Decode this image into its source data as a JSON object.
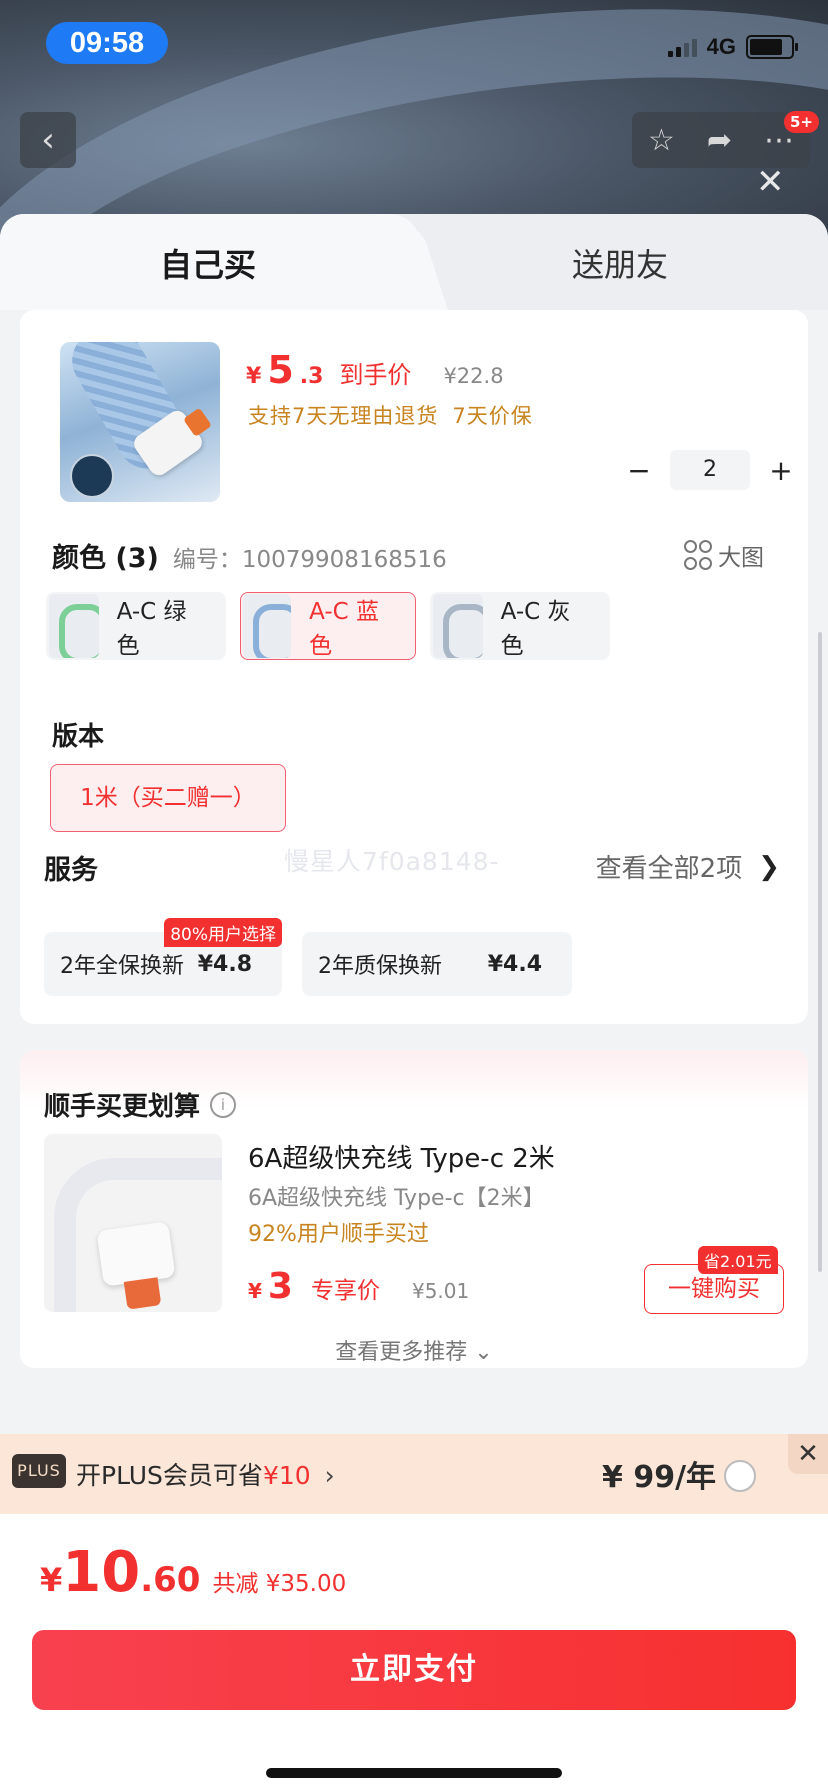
{
  "status_bar": {
    "time": "09:58",
    "network": "4G"
  },
  "nav": {
    "back_icon": "‹",
    "badge": "5+"
  },
  "tabs": [
    {
      "label": "自己买"
    },
    {
      "label": "送朋友"
    }
  ],
  "product": {
    "price_symbol": "¥",
    "price_int": "5",
    "price_dec": ".3",
    "price_tag": "到手价",
    "original_price": "¥22.8",
    "policies": [
      "支持7天无理由退货",
      "7天价保"
    ],
    "quantity": "2"
  },
  "color_section": {
    "title": "颜色 (3)",
    "sku": "编号：10079908168516",
    "big_image_label": "大图",
    "options": [
      {
        "label": "A-C 绿色",
        "selected": false,
        "swatch": "#7ccf96"
      },
      {
        "label": "A-C 蓝色",
        "selected": true,
        "swatch": "#8ab0d9"
      },
      {
        "label": "A-C 灰色",
        "selected": false,
        "swatch": "#a8b6c6"
      }
    ]
  },
  "version_section": {
    "title": "版本",
    "option": "1米（买二赠一）"
  },
  "service_section": {
    "title": "服务",
    "watermark": "慢星人7f0a8148-",
    "view_all": "查看全部2项",
    "options": [
      {
        "label": "2年全保换新",
        "price": "¥4.8",
        "badge": "80%用户选择"
      },
      {
        "label": "2年质保换新",
        "price": "¥4.4"
      }
    ]
  },
  "recommend": {
    "title": "顺手买更划算",
    "name": "6A超级快充线 Type-c 2米",
    "sub": "6A超级快充线 Type-c【2米】",
    "pct": "92%用户顺手买过",
    "price_symbol": "¥",
    "price": "3",
    "price_tag": "专享价",
    "original_price": "¥5.01",
    "save_tag": "省2.01元",
    "buy_label": "一键购买",
    "more_label": "查看更多推荐"
  },
  "plus_bar": {
    "logo": "PLUS",
    "text": "开PLUS会员可省",
    "amount": "¥10",
    "price": "¥ 99/年"
  },
  "checkout": {
    "symbol": "¥",
    "total_int": "10",
    "total_dec": ".60",
    "saved": "共减 ¥35.00",
    "pay_label": "立即支付"
  },
  "colors": {
    "accent": "#f23030",
    "policy": "#c88420",
    "plus_bg": "#fbe6d8"
  }
}
